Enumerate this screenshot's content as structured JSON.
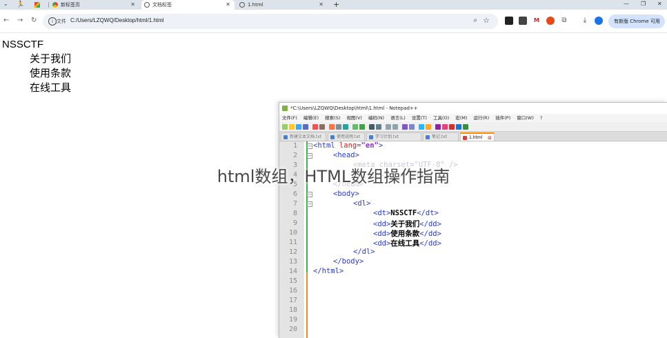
{
  "browser": {
    "tabs": [
      {
        "label": "",
        "type": "pinned"
      },
      {
        "label": "",
        "type": "pinned"
      },
      {
        "label": "新标签页"
      },
      {
        "label": "文档标签"
      },
      {
        "label": "1.html"
      }
    ],
    "new_tab_symbol": "+",
    "close_symbol": "✕",
    "url_prefix_label": "文件",
    "url": "C:/Users/LZQWQ/Desktop/html/1.html",
    "new_chrome_label": "有新版 Chrome 可用"
  },
  "page": {
    "dt": "NSSCTF",
    "dd": [
      "关于我们",
      "使用条款",
      "在线工具"
    ]
  },
  "notepad": {
    "title": "*C:\\Users\\LZQWQ\\Desktop\\html\\1.html - Notepad++",
    "menu": [
      "文件(F)",
      "编辑(E)",
      "搜索(S)",
      "视图(V)",
      "编码(N)",
      "语言(L)",
      "设置(T)",
      "工具(O)",
      "宏(M)",
      "运行(R)",
      "插件(P)",
      "窗口(W)",
      "?"
    ],
    "tabs": [
      "新建文本文档.txt",
      "使用说明.txt",
      "学习计划.txt",
      "笔记.txt",
      "1.html"
    ],
    "line_numbers": [
      "1",
      "2",
      "3",
      "4",
      "5",
      "6",
      "7",
      "8",
      "9",
      "10",
      "11",
      "12",
      "13",
      "14",
      "15",
      "16",
      "17",
      "18",
      "19",
      "20"
    ],
    "code": {
      "l1_open": "<html ",
      "l1_attr": "lang=",
      "l1_val": "\"en\"",
      "l1_close": ">",
      "l2": "<head>",
      "l3": "<meta charset=\"UTF-8\" />",
      "l4": "<title>文档</title>",
      "l5": "</head>",
      "l6": "<body>",
      "l7": "<dl>",
      "dt_open": "<dt>",
      "dt_text": "NSSCTF",
      "dt_close": "</dt>",
      "dd_open": "<dd>",
      "dd_close": "</dd>",
      "dd1": "关于我们",
      "dd2": "使用条款",
      "dd3": "在线工具",
      "l12": "</dl>",
      "l13": "</body>",
      "l14": "</html>"
    }
  },
  "watermark": "html数组，HTML数组操作指南",
  "colors": {
    "tag": "#2b3bd0",
    "attr": "#d21f1f",
    "value": "#8a2ad0",
    "saved_bar": "#3bb34a",
    "unsaved_bar": "#f08a24"
  }
}
